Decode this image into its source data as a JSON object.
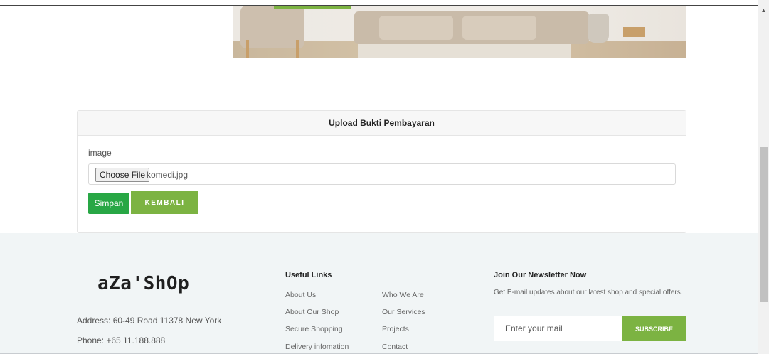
{
  "upload": {
    "title": "Upload Bukti Pembayaran",
    "field_label": "image",
    "choose_button": "Choose File",
    "file_name": "komedi.jpg",
    "save_button": "Simpan",
    "back_button": "KEMBALI"
  },
  "footer": {
    "logo_text": "aZa'ShOp",
    "address": "Address: 60-49 Road 11378 New York",
    "phone": "Phone: +65 11.188.888",
    "useful_links": {
      "title": "Useful Links",
      "col1": [
        "About Us",
        "About Our Shop",
        "Secure Shopping",
        "Delivery infomation"
      ],
      "col2": [
        "Who We Are",
        "Our Services",
        "Projects",
        "Contact"
      ]
    },
    "newsletter": {
      "title": "Join Our Newsletter Now",
      "description": "Get E-mail updates about our latest shop and special offers.",
      "placeholder": "Enter your mail",
      "subscribe_button": "SUBSCRIBE"
    }
  },
  "colors": {
    "accent_green": "#7cb342",
    "save_green": "#28a745",
    "footer_bg": "#f1f5f6"
  },
  "icons": {
    "scroll_up": "scroll-up-arrow-icon"
  }
}
